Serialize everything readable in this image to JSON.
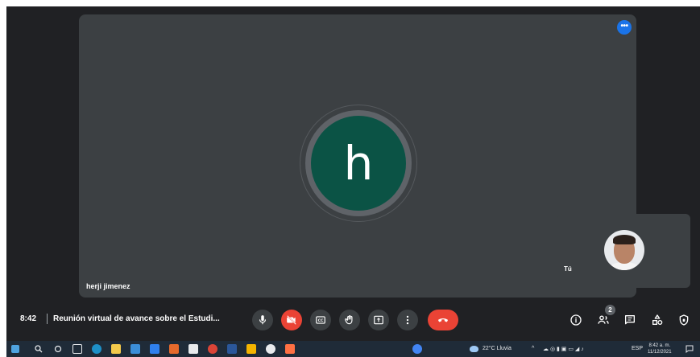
{
  "main_tile": {
    "avatar_letter": "h",
    "participant_name": "herji jimenez",
    "menu_icon": "more-horiz-icon"
  },
  "self_tile": {
    "label": "Tú"
  },
  "bottom_bar": {
    "time": "8:42",
    "meeting_title": "Reunión virtual de avance sobre el Estudi...",
    "controls": [
      {
        "name": "microphone",
        "icon": "mic-icon",
        "state": "on"
      },
      {
        "name": "camera",
        "icon": "videocam-off-icon",
        "state": "off"
      },
      {
        "name": "captions",
        "icon": "cc-icon"
      },
      {
        "name": "raise-hand",
        "icon": "hand-icon"
      },
      {
        "name": "present",
        "icon": "present-screen-icon"
      },
      {
        "name": "more-options",
        "icon": "more-vert-icon"
      },
      {
        "name": "leave-call",
        "icon": "call-end-icon"
      }
    ],
    "right_controls": [
      {
        "name": "meeting-details",
        "icon": "info-icon"
      },
      {
        "name": "people",
        "icon": "people-icon"
      },
      {
        "name": "chat",
        "icon": "chat-icon"
      },
      {
        "name": "activities",
        "icon": "activities-icon"
      },
      {
        "name": "host-controls",
        "icon": "shield-icon"
      }
    ],
    "people_count": "2"
  },
  "taskbar": {
    "weather": "22°C Lluvia",
    "language": "ESP",
    "clock_time": "8:42 a. m.",
    "clock_date": "11/12/2021"
  },
  "colors": {
    "meet_bg": "#202124",
    "tile_bg": "#3c4043",
    "avatar_bg": "#0b5345",
    "danger": "#ea4335",
    "accent": "#1a73e8",
    "taskbar_bg": "#1f2b38"
  }
}
